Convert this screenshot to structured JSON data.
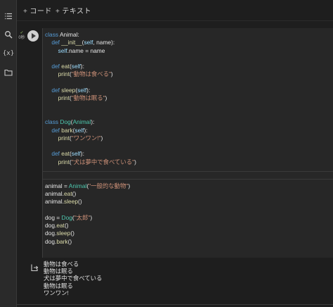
{
  "toolbar": {
    "add_code": "コード",
    "add_text": "テキスト"
  },
  "sidebar": {
    "items": [
      "toc-icon",
      "search-icon",
      "variables-icon",
      "folder-icon"
    ],
    "variables_glyph": "{x}"
  },
  "cell": {
    "exec_status": "✓",
    "exec_time": "0秒",
    "code_lines": [
      [
        {
          "t": "class ",
          "c": "kw"
        },
        {
          "t": "Animal:",
          "c": ""
        }
      ],
      [
        {
          "t": "    ",
          "c": ""
        },
        {
          "t": "def ",
          "c": "kw"
        },
        {
          "t": "__init__",
          "c": "fn"
        },
        {
          "t": "(",
          "c": ""
        },
        {
          "t": "self",
          "c": "self"
        },
        {
          "t": ", name):",
          "c": ""
        }
      ],
      [
        {
          "t": "        ",
          "c": ""
        },
        {
          "t": "self",
          "c": "self"
        },
        {
          "t": ".name = name",
          "c": ""
        }
      ],
      [],
      [
        {
          "t": "    ",
          "c": ""
        },
        {
          "t": "def ",
          "c": "kw"
        },
        {
          "t": "eat",
          "c": "fn"
        },
        {
          "t": "(",
          "c": ""
        },
        {
          "t": "self",
          "c": "self"
        },
        {
          "t": "):",
          "c": ""
        }
      ],
      [
        {
          "t": "        ",
          "c": ""
        },
        {
          "t": "print",
          "c": "fn"
        },
        {
          "t": "(",
          "c": ""
        },
        {
          "t": "\"動物は食べる\"",
          "c": "str"
        },
        {
          "t": ")",
          "c": ""
        }
      ],
      [],
      [
        {
          "t": "    ",
          "c": ""
        },
        {
          "t": "def ",
          "c": "kw"
        },
        {
          "t": "sleep",
          "c": "fn"
        },
        {
          "t": "(",
          "c": ""
        },
        {
          "t": "self",
          "c": "self"
        },
        {
          "t": "):",
          "c": ""
        }
      ],
      [
        {
          "t": "        ",
          "c": ""
        },
        {
          "t": "print",
          "c": "fn"
        },
        {
          "t": "(",
          "c": ""
        },
        {
          "t": "\"動物は眠る\"",
          "c": "str"
        },
        {
          "t": ")",
          "c": ""
        }
      ],
      [],
      [],
      [
        {
          "t": "class ",
          "c": "kw"
        },
        {
          "t": "Dog",
          "c": "cls"
        },
        {
          "t": "(",
          "c": ""
        },
        {
          "t": "Animal",
          "c": "cls"
        },
        {
          "t": "):",
          "c": ""
        }
      ],
      [
        {
          "t": "    ",
          "c": ""
        },
        {
          "t": "def ",
          "c": "kw"
        },
        {
          "t": "bark",
          "c": "fn"
        },
        {
          "t": "(",
          "c": ""
        },
        {
          "t": "self",
          "c": "self"
        },
        {
          "t": "):",
          "c": ""
        }
      ],
      [
        {
          "t": "        ",
          "c": ""
        },
        {
          "t": "print",
          "c": "fn"
        },
        {
          "t": "(",
          "c": ""
        },
        {
          "t": "\"ワンワン!\"",
          "c": "str"
        },
        {
          "t": ")",
          "c": ""
        }
      ],
      [],
      [
        {
          "t": "    ",
          "c": ""
        },
        {
          "t": "def ",
          "c": "kw"
        },
        {
          "t": "eat",
          "c": "fn"
        },
        {
          "t": "(",
          "c": ""
        },
        {
          "t": "self",
          "c": "self"
        },
        {
          "t": "):",
          "c": ""
        }
      ],
      [
        {
          "t": "        ",
          "c": ""
        },
        {
          "t": "print",
          "c": "fn"
        },
        {
          "t": "(",
          "c": ""
        },
        {
          "t": "\"犬は夢中で食べている\"",
          "c": "str"
        },
        {
          "t": ")",
          "c": ""
        }
      ],
      [],
      [],
      [
        {
          "t": "animal = ",
          "c": ""
        },
        {
          "t": "Animal",
          "c": "cls"
        },
        {
          "t": "(",
          "c": ""
        },
        {
          "t": "\"一般的な動物\"",
          "c": "str"
        },
        {
          "t": ")",
          "c": ""
        }
      ],
      [
        {
          "t": "animal.",
          "c": ""
        },
        {
          "t": "eat",
          "c": "fn"
        },
        {
          "t": "()",
          "c": ""
        }
      ],
      [
        {
          "t": "animal.",
          "c": ""
        },
        {
          "t": "sleep",
          "c": "fn"
        },
        {
          "t": "()",
          "c": ""
        }
      ],
      [],
      [
        {
          "t": "dog = ",
          "c": ""
        },
        {
          "t": "Dog",
          "c": "cls"
        },
        {
          "t": "(",
          "c": ""
        },
        {
          "t": "\"太郎\"",
          "c": "str"
        },
        {
          "t": ")",
          "c": ""
        }
      ],
      [
        {
          "t": "dog.",
          "c": ""
        },
        {
          "t": "eat",
          "c": "fn"
        },
        {
          "t": "()",
          "c": ""
        }
      ],
      [
        {
          "t": "dog.",
          "c": ""
        },
        {
          "t": "sleep",
          "c": "fn"
        },
        {
          "t": "()",
          "c": ""
        }
      ],
      [
        {
          "t": "dog.",
          "c": ""
        },
        {
          "t": "bark",
          "c": "fn"
        },
        {
          "t": "()",
          "c": ""
        }
      ]
    ]
  },
  "output": {
    "lines": [
      "動物は食べる",
      "動物は眠る",
      "犬は夢中で食べている",
      "動物は眠る",
      "ワンワン!"
    ]
  },
  "colors": {
    "keyword": "#569cd6",
    "function": "#dcdcaa",
    "class": "#4ec9b0",
    "string": "#ce9178",
    "background": "#1e1e1e"
  }
}
